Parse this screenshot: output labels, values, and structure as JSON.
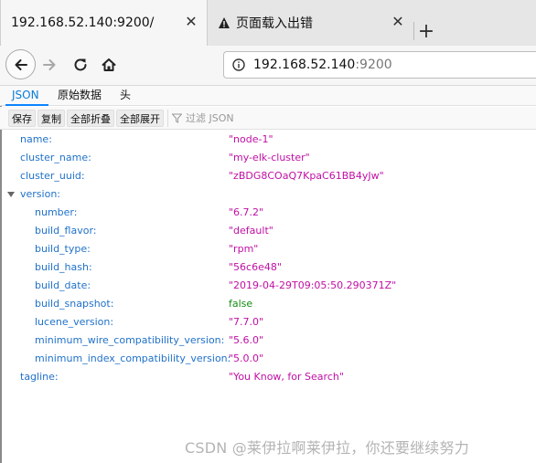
{
  "browser": {
    "tabs": [
      {
        "title": "192.168.52.140:9200/",
        "active": true
      },
      {
        "title": "页面载入出错",
        "active": false
      }
    ],
    "close_glyph": "✕",
    "new_tab_glyph": "+",
    "url": {
      "host": "192.168.52.140",
      "port": ":9200"
    },
    "icons": [
      "back-arrow-icon",
      "forward-arrow-icon",
      "reload-icon",
      "home-icon",
      "info-icon",
      "warning-icon"
    ]
  },
  "viewer": {
    "tabs": [
      "JSON",
      "原始数据",
      "头"
    ],
    "selected_tab": "JSON",
    "toolbar": {
      "save": "保存",
      "copy": "复制",
      "collapse_all": "全部折叠",
      "expand_all": "全部展开",
      "filter_placeholder": "过滤 JSON"
    }
  },
  "json_tree": [
    {
      "key": "name:",
      "value": "\"node-1\"",
      "type": "string",
      "level": 0
    },
    {
      "key": "cluster_name:",
      "value": "\"my-elk-cluster\"",
      "type": "string",
      "level": 0
    },
    {
      "key": "cluster_uuid:",
      "value": "\"zBDG8COaQ7KpaC61BB4yJw\"",
      "type": "string",
      "level": 0
    },
    {
      "key": "version:",
      "value": "",
      "type": "object",
      "level": 0,
      "expanded": true
    },
    {
      "key": "number:",
      "value": "\"6.7.2\"",
      "type": "string",
      "level": 1
    },
    {
      "key": "build_flavor:",
      "value": "\"default\"",
      "type": "string",
      "level": 1
    },
    {
      "key": "build_type:",
      "value": "\"rpm\"",
      "type": "string",
      "level": 1
    },
    {
      "key": "build_hash:",
      "value": "\"56c6e48\"",
      "type": "string",
      "level": 1
    },
    {
      "key": "build_date:",
      "value": "\"2019-04-29T09:05:50.290371Z\"",
      "type": "string",
      "level": 1
    },
    {
      "key": "build_snapshot:",
      "value": "false",
      "type": "boolean",
      "level": 1
    },
    {
      "key": "lucene_version:",
      "value": "\"7.7.0\"",
      "type": "string",
      "level": 1
    },
    {
      "key": "minimum_wire_compatibility_version:",
      "value": "\"5.6.0\"",
      "type": "string",
      "level": 1
    },
    {
      "key": "minimum_index_compatibility_version:",
      "value": "\"5.0.0\"",
      "type": "string",
      "level": 1
    },
    {
      "key": "tagline:",
      "value": "\"You Know, for Search\"",
      "type": "string",
      "level": 0
    }
  ],
  "colors": {
    "key": "#1f71c9",
    "string": "#c00fa4",
    "boolean": "#138b13",
    "accent": "#0a84ff"
  },
  "watermark": "CSDN @莱伊拉啊莱伊拉，你还要继续努力"
}
